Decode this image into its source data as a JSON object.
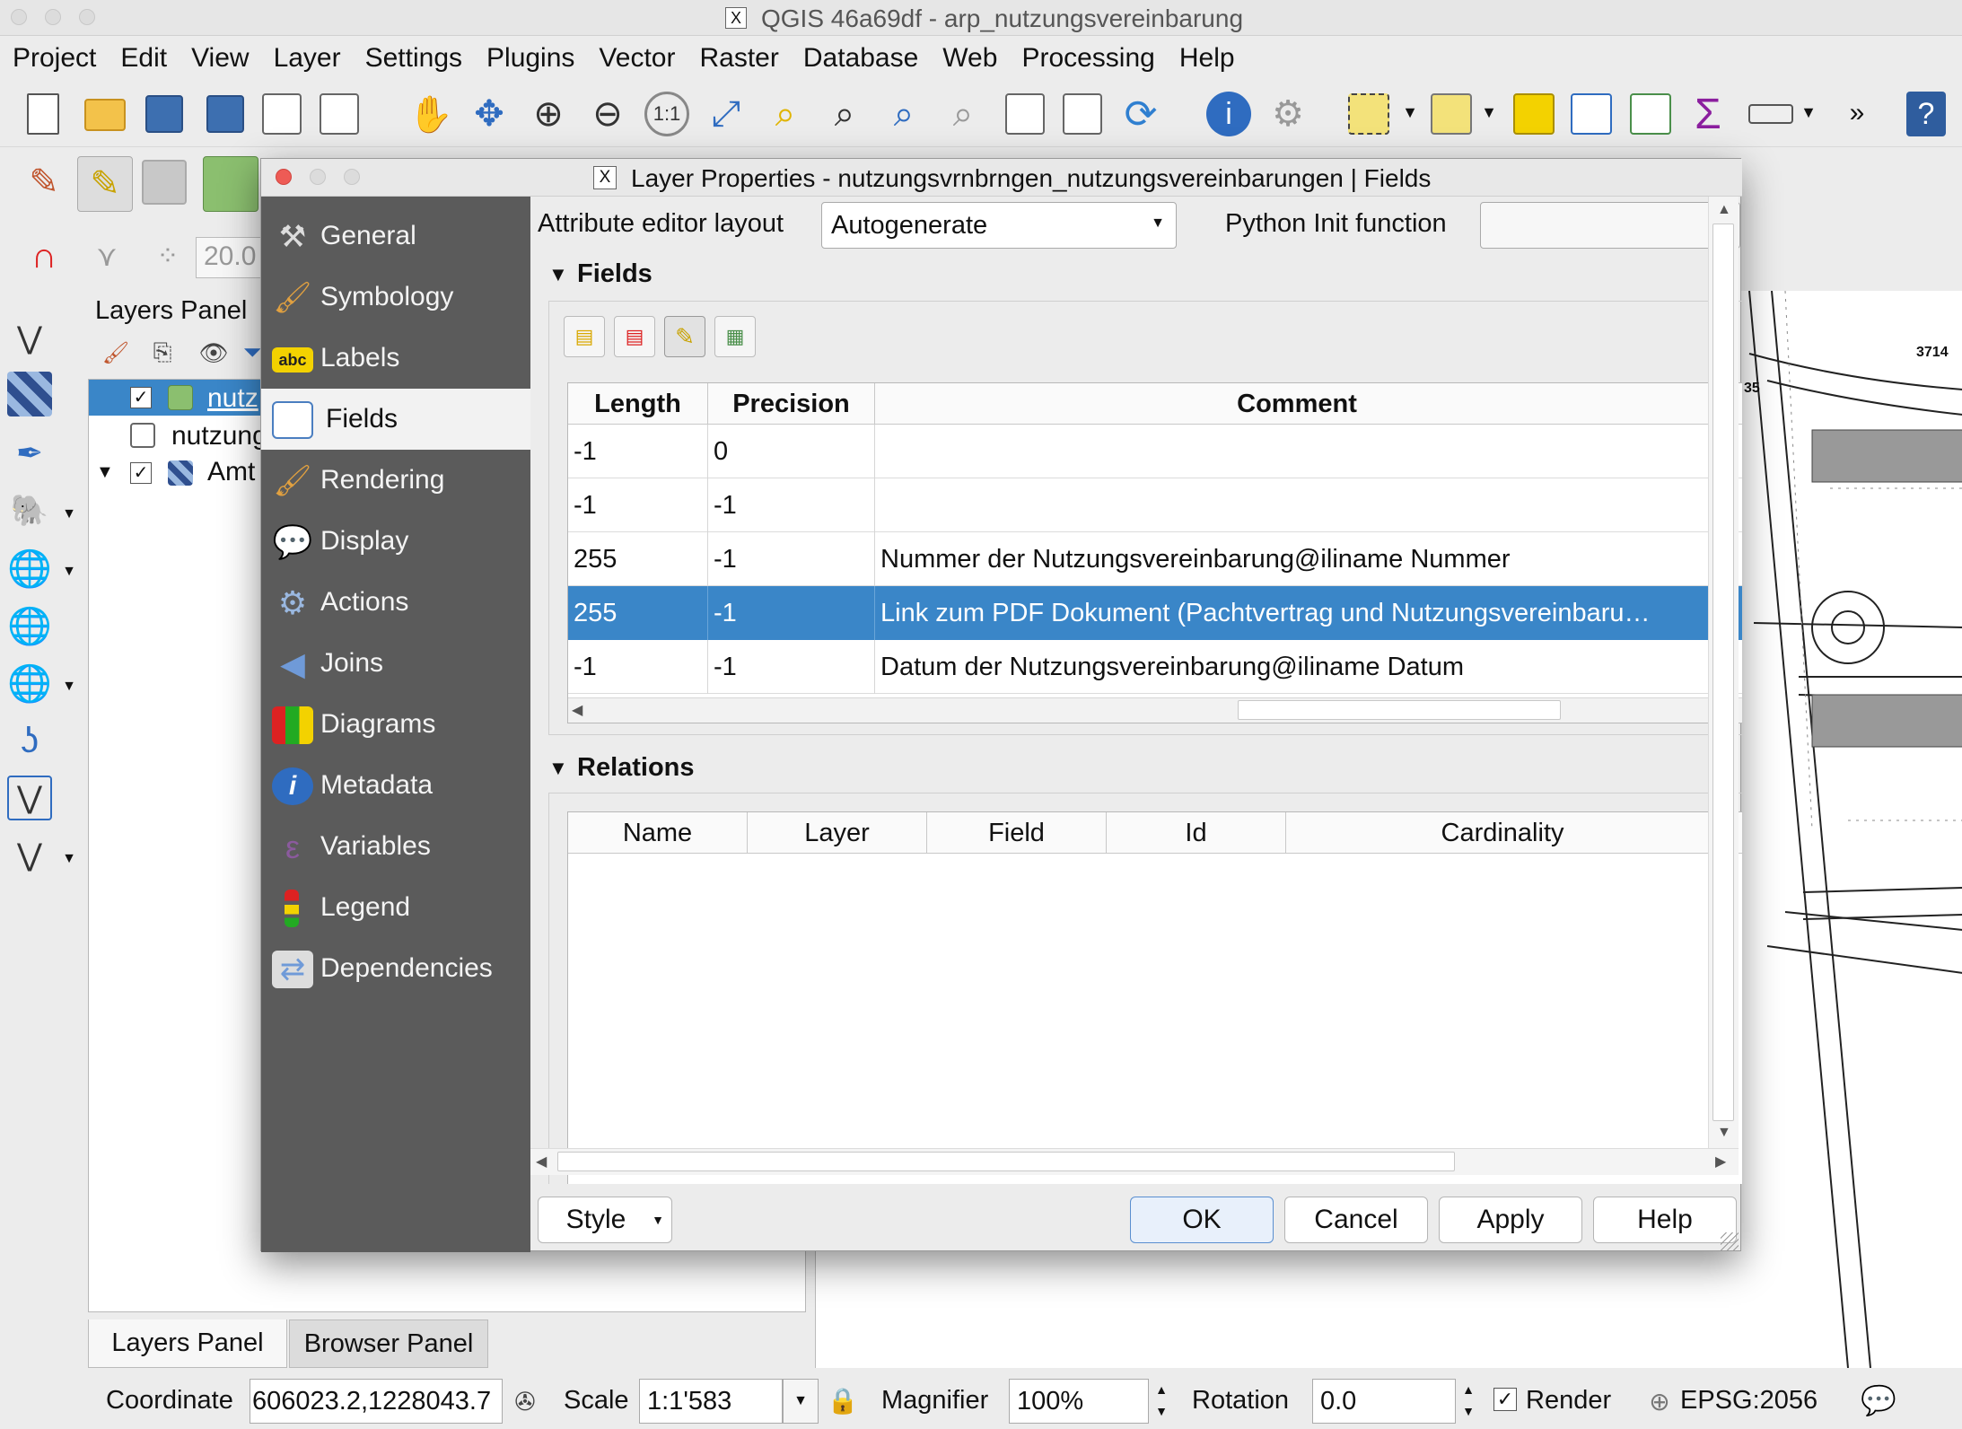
{
  "window": {
    "title": "QGIS 46a69df - arp_nutzungsvereinbarung"
  },
  "menubar": [
    "Project",
    "Edit",
    "View",
    "Layer",
    "Settings",
    "Plugins",
    "Vector",
    "Raster",
    "Database",
    "Web",
    "Processing",
    "Help"
  ],
  "toolbar2": {
    "scale_value": "20.0"
  },
  "layers_panel": {
    "title": "Layers Panel",
    "items": [
      {
        "label": "nutz",
        "checked": true
      },
      {
        "label": "nutzung",
        "checked": false
      },
      {
        "label": "Amt",
        "checked": true
      }
    ],
    "tabs": [
      "Layers Panel",
      "Browser Panel"
    ]
  },
  "dialog": {
    "title": "Layer Properties - nutzungsvrnbrngen_nutzungsvereinbarungen | Fields",
    "sidebar": [
      "General",
      "Symbology",
      "Labels",
      "Fields",
      "Rendering",
      "Display",
      "Actions",
      "Joins",
      "Diagrams",
      "Metadata",
      "Variables",
      "Legend",
      "Dependencies"
    ],
    "active_tab": "Fields",
    "attr_layout_label": "Attribute editor layout",
    "attr_layout_value": "Autogenerate",
    "python_init_label": "Python Init function",
    "python_init_value": "",
    "fields_section": "Fields",
    "fields_table": {
      "columns": [
        "Length",
        "Precision",
        "Comment"
      ],
      "rows": [
        [
          "-1",
          "0",
          ""
        ],
        [
          "-1",
          "-1",
          ""
        ],
        [
          "255",
          "-1",
          "Nummer der Nutzungsvereinbarung@iliname Nummer"
        ],
        [
          "255",
          "-1",
          "Link zum PDF Dokument (Pachtvertrag und Nutzungsvereinbaru…"
        ],
        [
          "-1",
          "-1",
          "Datum der Nutzungsvereinbarung@iliname Datum"
        ]
      ],
      "selected_row": 3
    },
    "relations_section": "Relations",
    "relations_table": {
      "columns": [
        "Name",
        "Layer",
        "Field",
        "Id",
        "Cardinality"
      ]
    },
    "buttons": {
      "style": "Style",
      "ok": "OK",
      "cancel": "Cancel",
      "apply": "Apply",
      "help": "Help"
    }
  },
  "map": {
    "parcel_label_1": "3714",
    "parcel_label_2": "35"
  },
  "statusbar": {
    "coordinate_label": "Coordinate",
    "coordinate_value": "606023.2,1228043.7",
    "scale_label": "Scale",
    "scale_value": "1:1'583",
    "magnifier_label": "Magnifier",
    "magnifier_value": "100%",
    "rotation_label": "Rotation",
    "rotation_value": "0.0",
    "render_label": "Render",
    "crs": "EPSG:2056"
  },
  "colors": {
    "selection": "#3a86c8",
    "sidebar_bg": "#5b5b5b",
    "sidebar_active": "#f2f2f2",
    "close_red": "#ee5b55"
  }
}
